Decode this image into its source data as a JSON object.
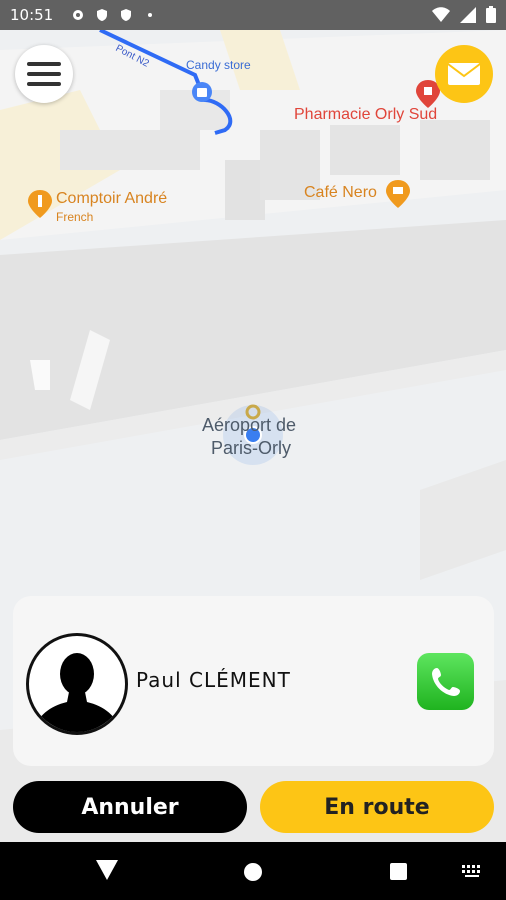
{
  "status_bar": {
    "time": "10:51",
    "icons": [
      "gear-icon",
      "shield-icon",
      "shield-icon",
      "dot-icon"
    ],
    "right_icons": [
      "wifi-icon",
      "signal-icon",
      "battery-icon"
    ]
  },
  "map": {
    "pois": {
      "candy_store": "Candy store",
      "pharmacie": "Pharmacie Orly Sud",
      "comptoir": "Comptoir André",
      "comptoir_sub": "French",
      "cafe": "Café Nero",
      "airport_line1": "Aéroport de",
      "airport_line2": "Paris-Orly",
      "road": "Pont N2"
    },
    "colors": {
      "route": "#2f6bf5",
      "poi_orange": "#f09a1e",
      "poi_red": "#e0453a",
      "poi_blue": "#4a86f7"
    }
  },
  "controls": {
    "menu_icon": "hamburger-menu-icon",
    "mail_icon": "envelope-icon"
  },
  "driver": {
    "name": "Paul CLÉMENT",
    "avatar_icon": "person-silhouette-icon",
    "call_icon": "phone-icon"
  },
  "actions": {
    "cancel_label": "Annuler",
    "en_route_label": "En route"
  },
  "colors": {
    "accent_yellow": "#fdc515",
    "cancel_black": "#000000",
    "call_green": "#2fc12f"
  },
  "nav": [
    "back-icon",
    "home-icon",
    "recents-icon",
    "keyboard-icon"
  ]
}
